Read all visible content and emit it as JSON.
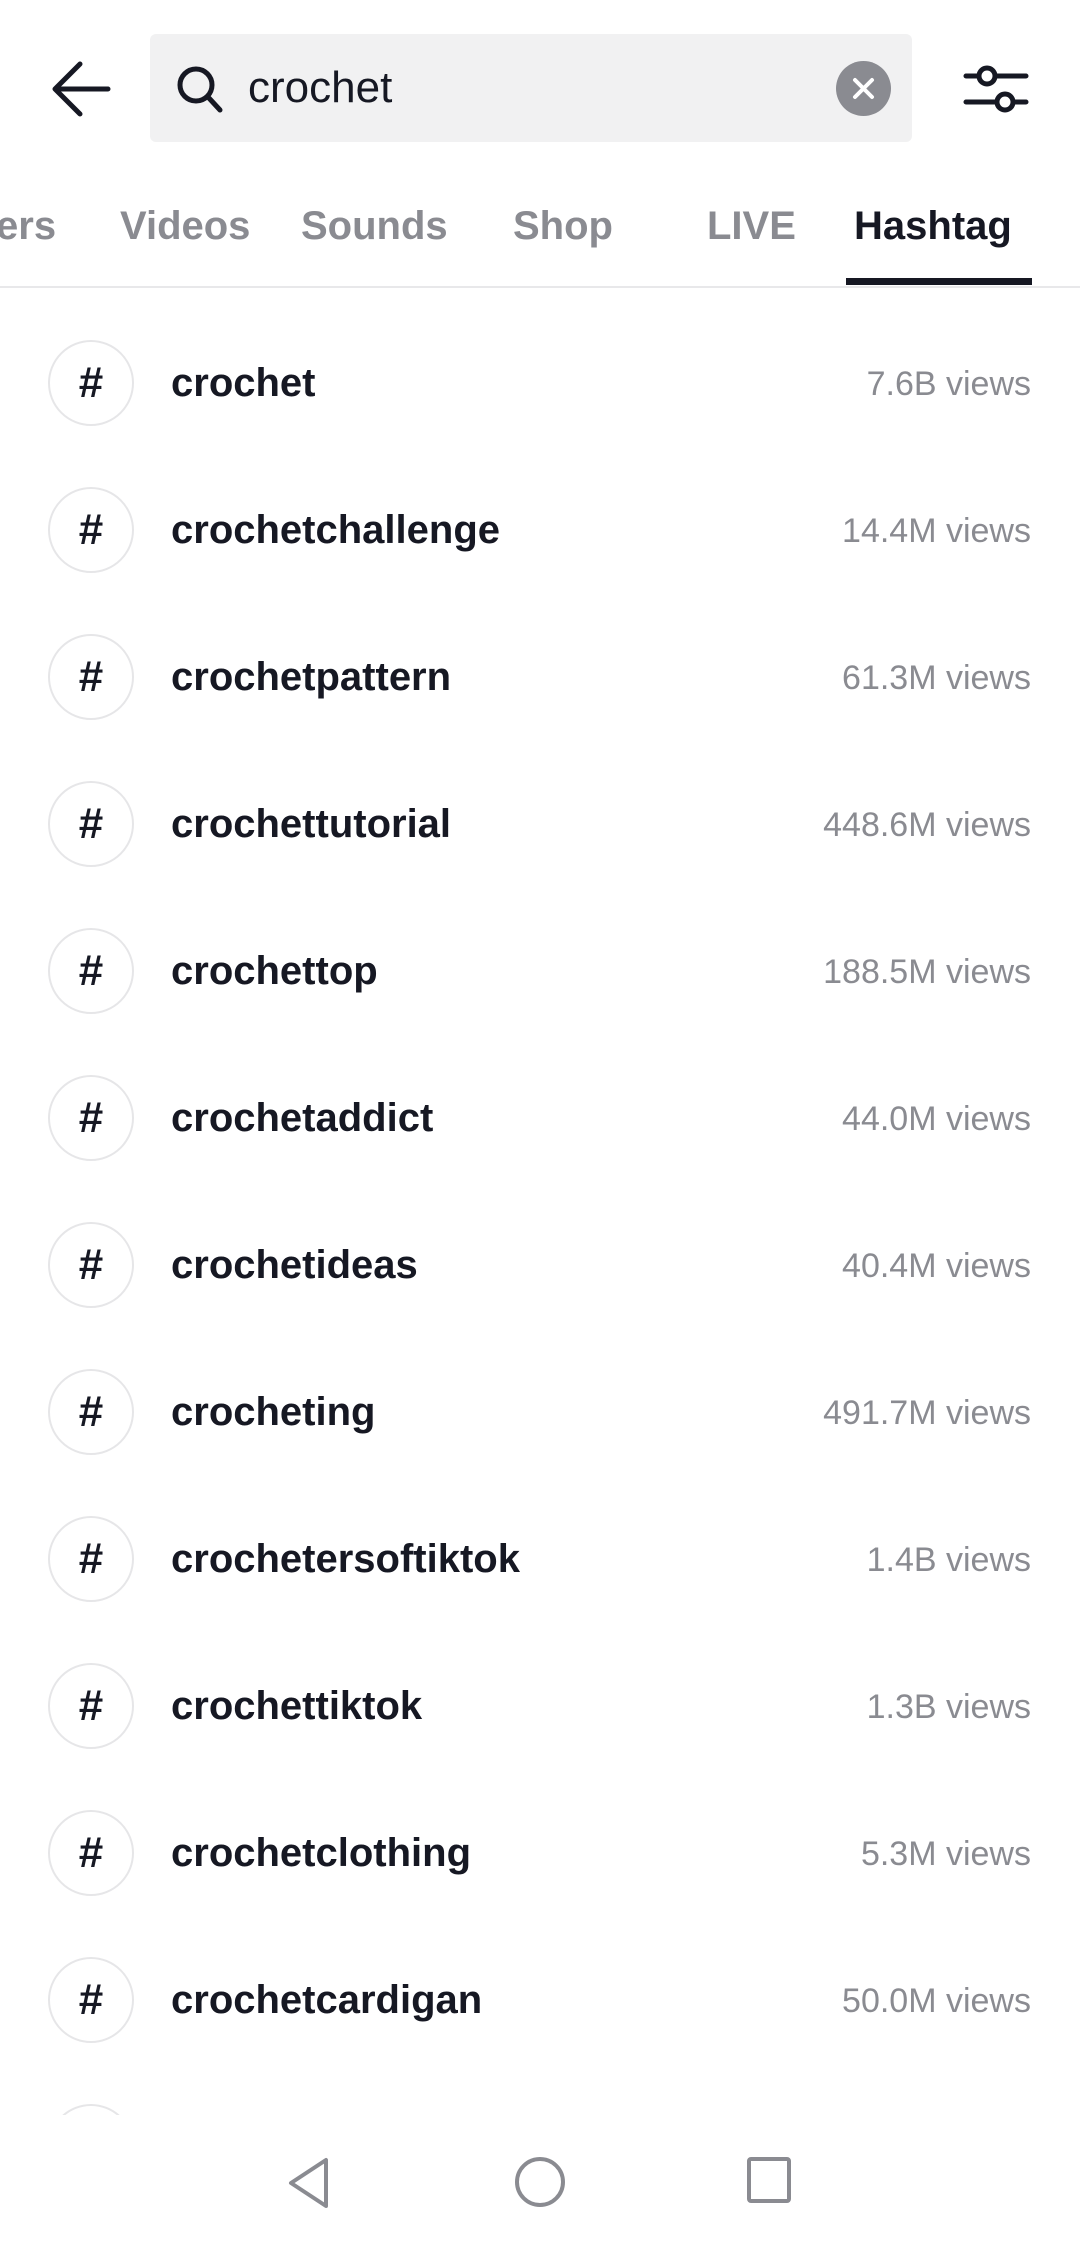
{
  "header": {
    "search_value": "crochet",
    "back_icon": "arrow-left-icon",
    "search_icon": "search-icon",
    "clear_icon": "clear-icon",
    "filter_icon": "sliders-icon"
  },
  "tabs": [
    {
      "label": "ers"
    },
    {
      "label": "Videos"
    },
    {
      "label": "Sounds"
    },
    {
      "label": "Shop"
    },
    {
      "label": "LIVE"
    },
    {
      "label": "Hashtag",
      "active": true
    }
  ],
  "hashtags": [
    {
      "name": "crochet",
      "views": "7.6B views"
    },
    {
      "name": "crochetchallenge",
      "views": "14.4M views"
    },
    {
      "name": "crochetpattern",
      "views": "61.3M views"
    },
    {
      "name": "crochettutorial",
      "views": "448.6M views"
    },
    {
      "name": "crochettop",
      "views": "188.5M views"
    },
    {
      "name": "crochetaddict",
      "views": "44.0M views"
    },
    {
      "name": "crochetideas",
      "views": "40.4M views"
    },
    {
      "name": "crocheting",
      "views": "491.7M views"
    },
    {
      "name": "crochetersoftiktok",
      "views": "1.4B views"
    },
    {
      "name": "crochettiktok",
      "views": "1.3B views"
    },
    {
      "name": "crochetclothing",
      "views": "5.3M views"
    },
    {
      "name": "crochetcardigan",
      "views": "50.0M views"
    }
  ],
  "hash_symbol": "#",
  "colors": {
    "text": "#161823",
    "muted": "#8a8b91",
    "search_bg": "#f1f1f2"
  }
}
